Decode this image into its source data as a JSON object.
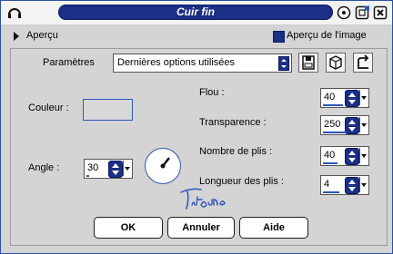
{
  "window": {
    "title": "Cuir fin"
  },
  "apercu": {
    "label": "Aperçu",
    "image_label": "Aperçu de l'image"
  },
  "parametres": {
    "label": "Paramètres",
    "preset_value": "Dernières options utilisées"
  },
  "couleur": {
    "label": "Couleur :",
    "swatch_color": "#d8d8d8"
  },
  "fields": {
    "flou_label": "Flou :",
    "flou_value": "40",
    "transparence_label": "Transparence :",
    "transparence_value": "250",
    "nombre_label": "Nombre de plis :",
    "nombre_value": "40",
    "longueur_label": "Longueur des plis :",
    "longueur_value": "4",
    "angle_label": "Angle :",
    "angle_value": "30"
  },
  "buttons": {
    "ok": "OK",
    "annuler": "Annuler",
    "aide": "Aide"
  },
  "colors": {
    "accent": "#1b2f86",
    "accent_light": "#2b56b8",
    "panel": "#d4d4d4"
  }
}
